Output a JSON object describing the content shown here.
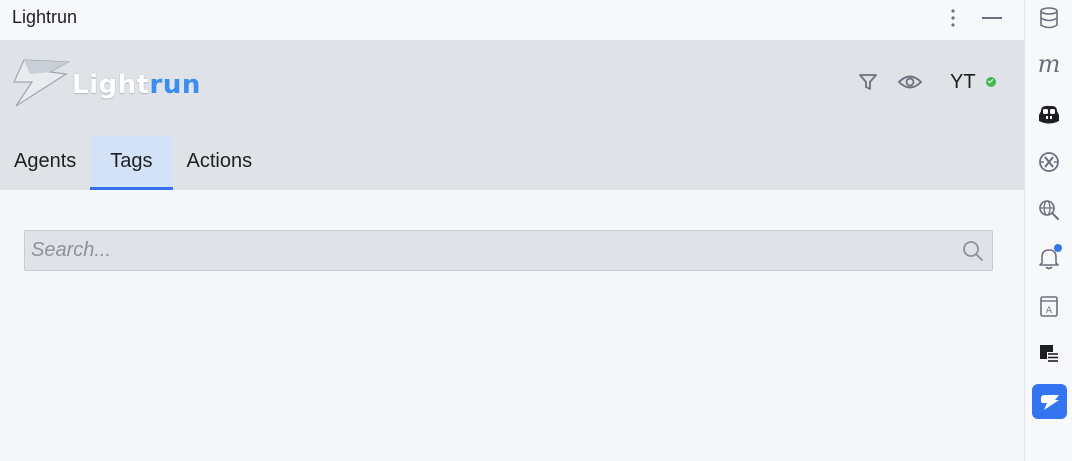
{
  "window": {
    "title": "Lightrun"
  },
  "header": {
    "logo_text_light": "Light",
    "logo_text_run": "run",
    "user_initials": "YT",
    "status_color": "#3fb950"
  },
  "tabs": [
    {
      "label": "Agents",
      "active": false
    },
    {
      "label": "Tags",
      "active": true
    },
    {
      "label": "Actions",
      "active": false
    }
  ],
  "search": {
    "placeholder": "Search...",
    "value": ""
  },
  "sidebar": {
    "items": [
      {
        "name": "database-icon"
      },
      {
        "name": "m-icon",
        "text": "m"
      },
      {
        "name": "copilot-icon"
      },
      {
        "name": "endpoints-icon"
      },
      {
        "name": "web-search-icon"
      },
      {
        "name": "notifications-icon",
        "badge": true
      },
      {
        "name": "translation-icon"
      },
      {
        "name": "structure-icon"
      },
      {
        "name": "lightrun-icon",
        "active": true
      }
    ]
  },
  "colors": {
    "accent": "#3574f0",
    "header_bg": "#dfe3e8",
    "active_tab_bg": "#d4e2f7"
  }
}
